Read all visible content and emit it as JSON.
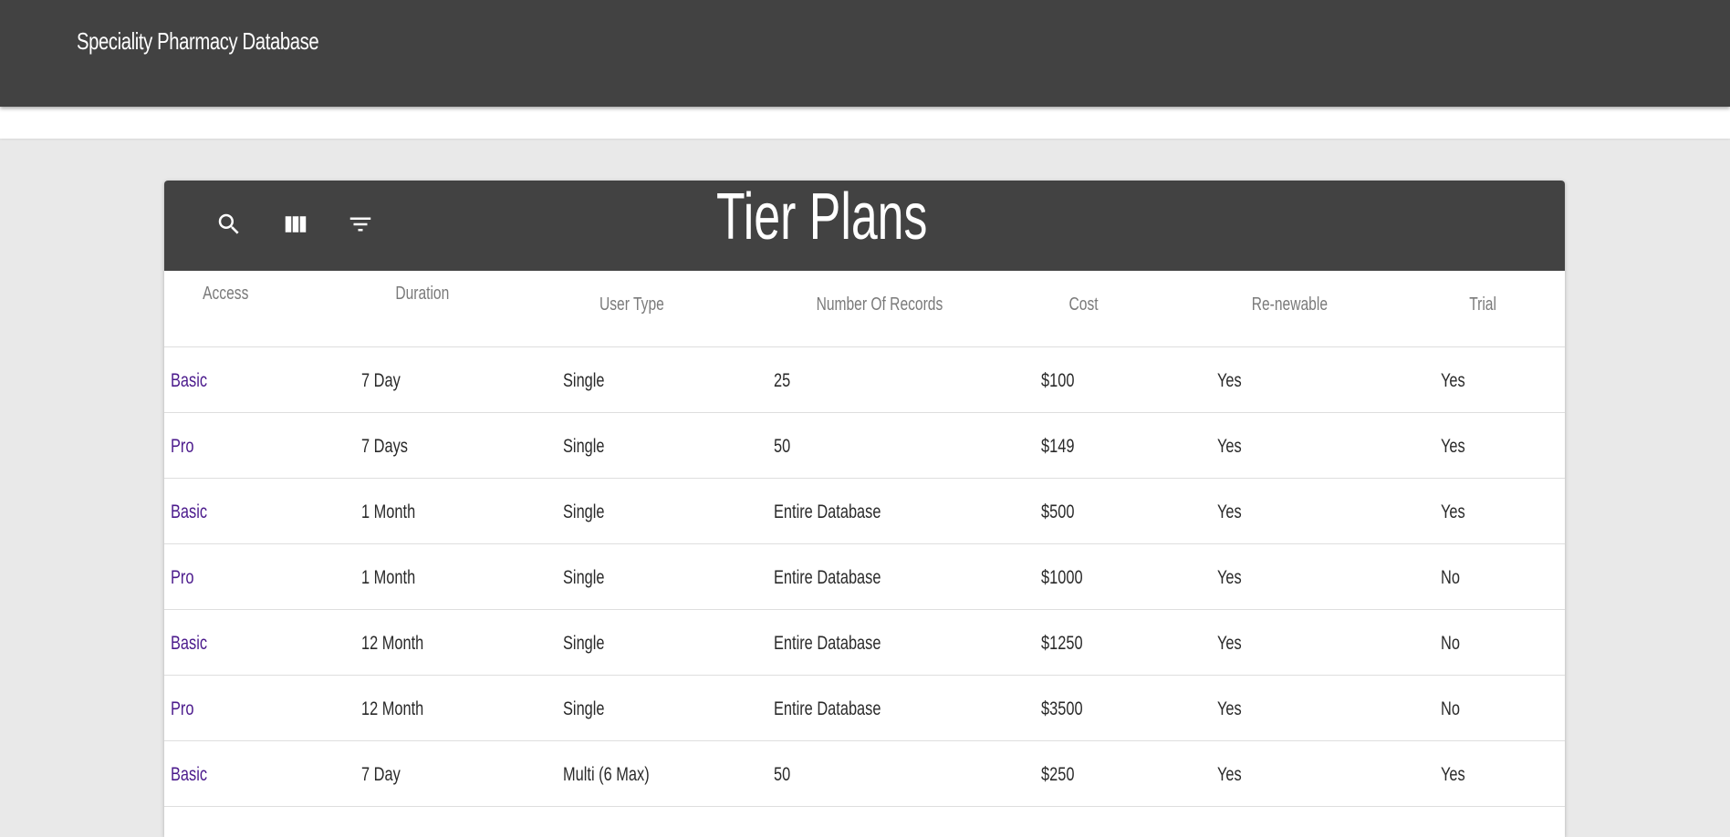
{
  "app": {
    "title": "Speciality Pharmacy Database"
  },
  "card": {
    "title": "Tier Plans",
    "toolbar_icons": [
      "search-icon",
      "view-column-icon",
      "filter-list-icon"
    ]
  },
  "table": {
    "headers": [
      "Access",
      "Duration",
      "User Type",
      "Number Of Records",
      "Cost",
      "Re-newable",
      "Trial"
    ],
    "rows": [
      [
        "Basic",
        "7 Day",
        "Single",
        "25",
        "$100",
        "Yes",
        "Yes"
      ],
      [
        "Pro",
        "7 Days",
        "Single",
        "50",
        "$149",
        "Yes",
        "Yes"
      ],
      [
        "Basic",
        "1 Month",
        "Single",
        "Entire Database",
        "$500",
        "Yes",
        "Yes"
      ],
      [
        "Pro",
        "1 Month",
        "Single",
        "Entire Database",
        "$1000",
        "Yes",
        "No"
      ],
      [
        "Basic",
        "12 Month",
        "Single",
        "Entire Database",
        "$1250",
        "Yes",
        "No"
      ],
      [
        "Pro",
        "12 Month",
        "Single",
        "Entire Database",
        "$3500",
        "Yes",
        "No"
      ],
      [
        "Basic",
        "7 Day",
        "Multi (6 Max)",
        "50",
        "$250",
        "Yes",
        "Yes"
      ]
    ]
  },
  "colors": {
    "appbar": "#424242",
    "background": "#e9e9e9",
    "access_link": "#4b1a8c"
  }
}
